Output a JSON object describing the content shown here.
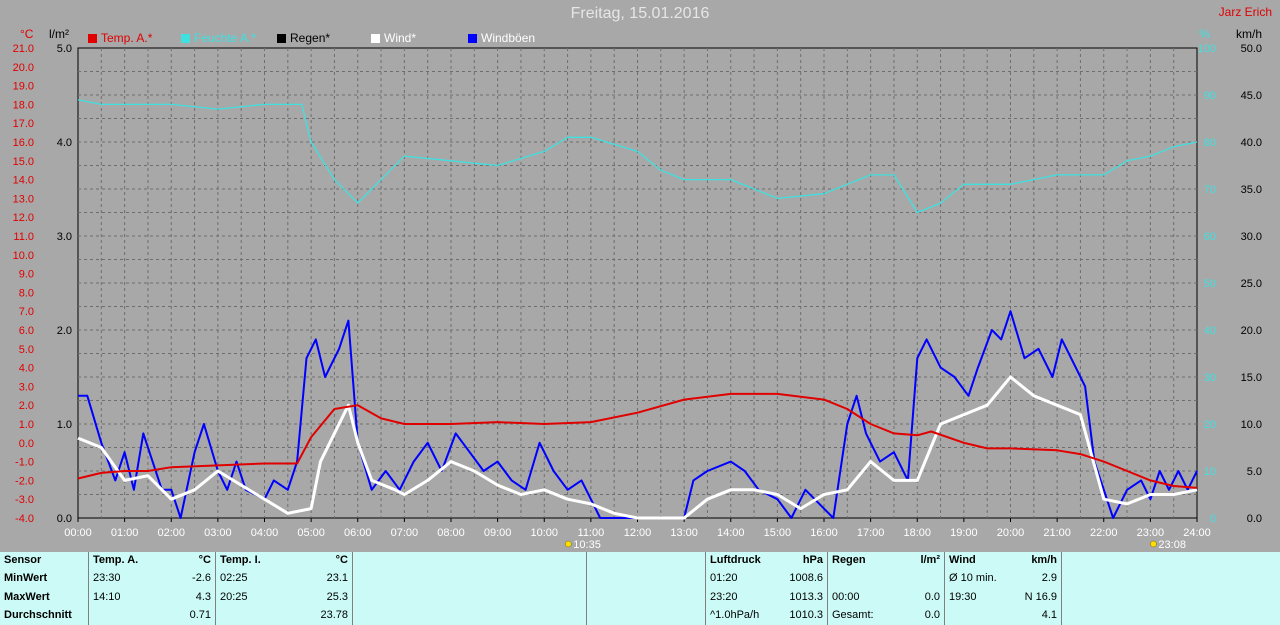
{
  "header": {
    "title": "Freitag, 15.01.2016",
    "author": "Jarz Erich"
  },
  "legend": [
    {
      "label": "Temp. A.*",
      "color": "#e00000",
      "labelColor": "#e00000"
    },
    {
      "label": "Feuchte A.*",
      "color": "#40e0e0",
      "labelColor": "#40e0e0"
    },
    {
      "label": "Regen*",
      "color": "#000000",
      "labelColor": "#000000"
    },
    {
      "label": "Wind*",
      "color": "#ffffff",
      "labelColor": "#ffffff"
    },
    {
      "label": "Windböen",
      "color": "#0000ff",
      "labelColor": "#ffffff"
    }
  ],
  "units": {
    "temp": "°C",
    "rain": "l/m²",
    "humidity": "%",
    "wind": "km/h"
  },
  "chart_data": {
    "type": "line",
    "title": "Freitag, 15.01.2016",
    "x_ticks": [
      "00:00",
      "01:00",
      "02:00",
      "03:00",
      "04:00",
      "05:00",
      "06:00",
      "07:00",
      "08:00",
      "09:00",
      "10:00",
      "11:00",
      "12:00",
      "13:00",
      "14:00",
      "15:00",
      "16:00",
      "17:00",
      "18:00",
      "19:00",
      "20:00",
      "21:00",
      "22:00",
      "23:00",
      "24:00"
    ],
    "x_range_hours": [
      0,
      24
    ],
    "axes": {
      "temp": {
        "unit": "°C",
        "min": -4,
        "max": 21,
        "step": 1,
        "ticks": [
          "-4.0",
          "-3.0",
          "-2.0",
          "-1.0",
          "0.0",
          "1.0",
          "2.0",
          "3.0",
          "4.0",
          "5.0",
          "6.0",
          "7.0",
          "8.0",
          "9.0",
          "10.0",
          "11.0",
          "12.0",
          "13.0",
          "14.0",
          "15.0",
          "16.0",
          "17.0",
          "18.0",
          "19.0",
          "20.0",
          "21.0"
        ]
      },
      "rain": {
        "unit": "l/m²",
        "min": 0,
        "max": 5,
        "ticks": [
          "0.0",
          "1.0",
          "2.0",
          "3.0",
          "4.0",
          "5.0"
        ]
      },
      "humidity": {
        "unit": "%",
        "min": 0,
        "max": 100,
        "ticks": [
          "0",
          "10",
          "20",
          "30",
          "40",
          "50",
          "60",
          "70",
          "80",
          "90",
          "100"
        ]
      },
      "wind": {
        "unit": "km/h",
        "min": 0,
        "max": 50,
        "ticks": [
          "0.0",
          "5.0",
          "10.0",
          "15.0",
          "20.0",
          "25.0",
          "30.0",
          "35.0",
          "40.0",
          "45.0",
          "50.0"
        ]
      }
    },
    "grid": true,
    "markers": [
      {
        "label": "10:35",
        "hour": 10.58
      },
      {
        "label": "23:08",
        "hour": 23.13
      }
    ],
    "series": [
      {
        "name": "Temp. A.*",
        "axis": "temp",
        "color": "#e00000",
        "points": [
          [
            0,
            -1.9
          ],
          [
            0.5,
            -1.6
          ],
          [
            1,
            -1.5
          ],
          [
            1.5,
            -1.5
          ],
          [
            2,
            -1.3
          ],
          [
            3,
            -1.2
          ],
          [
            4,
            -1.1
          ],
          [
            4.7,
            -1.1
          ],
          [
            5,
            0.3
          ],
          [
            5.5,
            1.8
          ],
          [
            6,
            2.0
          ],
          [
            6.5,
            1.3
          ],
          [
            7,
            1.0
          ],
          [
            8,
            1.0
          ],
          [
            9,
            1.1
          ],
          [
            10,
            1.0
          ],
          [
            11,
            1.1
          ],
          [
            12,
            1.6
          ],
          [
            13,
            2.3
          ],
          [
            14,
            2.6
          ],
          [
            15,
            2.6
          ],
          [
            16,
            2.3
          ],
          [
            16.5,
            1.8
          ],
          [
            17,
            1.0
          ],
          [
            17.5,
            0.5
          ],
          [
            18,
            0.4
          ],
          [
            18.3,
            0.6
          ],
          [
            19,
            0.0
          ],
          [
            19.5,
            -0.3
          ],
          [
            20,
            -0.3
          ],
          [
            21,
            -0.4
          ],
          [
            21.5,
            -0.6
          ],
          [
            22,
            -1.0
          ],
          [
            22.5,
            -1.5
          ],
          [
            23,
            -2.0
          ],
          [
            23.5,
            -2.3
          ],
          [
            24,
            -2.4
          ]
        ]
      },
      {
        "name": "Feuchte A.*",
        "axis": "humidity",
        "color": "#40e0e0",
        "points": [
          [
            0,
            89
          ],
          [
            0.5,
            88
          ],
          [
            1,
            88
          ],
          [
            2,
            88
          ],
          [
            3,
            87
          ],
          [
            4,
            88
          ],
          [
            4.8,
            88
          ],
          [
            5,
            80
          ],
          [
            5.5,
            72
          ],
          [
            6,
            67
          ],
          [
            6.5,
            72
          ],
          [
            7,
            77
          ],
          [
            8,
            76
          ],
          [
            9,
            75
          ],
          [
            10,
            78
          ],
          [
            10.5,
            81
          ],
          [
            11,
            81
          ],
          [
            12,
            78
          ],
          [
            12.5,
            74
          ],
          [
            13,
            72
          ],
          [
            14,
            72
          ],
          [
            15,
            68
          ],
          [
            16,
            69
          ],
          [
            17,
            73
          ],
          [
            17.5,
            73
          ],
          [
            18,
            65
          ],
          [
            18.5,
            67
          ],
          [
            19,
            71
          ],
          [
            20,
            71
          ],
          [
            21,
            73
          ],
          [
            22,
            73
          ],
          [
            22.5,
            76
          ],
          [
            23,
            77
          ],
          [
            23.5,
            79
          ],
          [
            24,
            80
          ]
        ]
      },
      {
        "name": "Wind*",
        "axis": "wind",
        "color": "#ffffff",
        "points": [
          [
            0,
            8.5
          ],
          [
            0.5,
            7.5
          ],
          [
            1,
            4
          ],
          [
            1.5,
            4.5
          ],
          [
            2,
            2
          ],
          [
            2.5,
            3
          ],
          [
            3,
            5
          ],
          [
            3.5,
            3.5
          ],
          [
            4,
            2
          ],
          [
            4.5,
            0.5
          ],
          [
            5,
            1
          ],
          [
            5.2,
            6
          ],
          [
            5.5,
            9
          ],
          [
            5.8,
            12
          ],
          [
            6,
            8
          ],
          [
            6.3,
            4
          ],
          [
            6.8,
            3
          ],
          [
            7,
            2.5
          ],
          [
            7.5,
            4
          ],
          [
            8,
            6
          ],
          [
            8.5,
            5
          ],
          [
            9,
            3.5
          ],
          [
            9.5,
            2.5
          ],
          [
            10,
            3
          ],
          [
            10.5,
            2
          ],
          [
            11,
            1.5
          ],
          [
            11.5,
            0.5
          ],
          [
            12,
            0
          ],
          [
            13,
            0
          ],
          [
            13.5,
            2
          ],
          [
            14,
            3
          ],
          [
            14.5,
            3
          ],
          [
            15,
            2.5
          ],
          [
            15.5,
            1
          ],
          [
            16,
            2.5
          ],
          [
            16.5,
            3
          ],
          [
            17,
            6
          ],
          [
            17.5,
            4
          ],
          [
            18,
            4
          ],
          [
            18.5,
            10
          ],
          [
            19,
            11
          ],
          [
            19.5,
            12
          ],
          [
            20,
            15
          ],
          [
            20.5,
            13
          ],
          [
            21,
            12
          ],
          [
            21.5,
            11
          ],
          [
            22,
            2
          ],
          [
            22.5,
            1.5
          ],
          [
            23,
            2.5
          ],
          [
            23.5,
            2.5
          ],
          [
            24,
            3
          ]
        ]
      },
      {
        "name": "Windböen",
        "axis": "wind",
        "color": "#0000ff",
        "points": [
          [
            0,
            13
          ],
          [
            0.2,
            13
          ],
          [
            0.5,
            8
          ],
          [
            0.8,
            4
          ],
          [
            1,
            7
          ],
          [
            1.2,
            3
          ],
          [
            1.4,
            9
          ],
          [
            1.6,
            6
          ],
          [
            1.8,
            3
          ],
          [
            2,
            3
          ],
          [
            2.2,
            0
          ],
          [
            2.5,
            7
          ],
          [
            2.7,
            10
          ],
          [
            3,
            5
          ],
          [
            3.2,
            3
          ],
          [
            3.4,
            6
          ],
          [
            3.6,
            3
          ],
          [
            4,
            2
          ],
          [
            4.2,
            4
          ],
          [
            4.5,
            3
          ],
          [
            4.7,
            6
          ],
          [
            4.9,
            17
          ],
          [
            5.1,
            19
          ],
          [
            5.3,
            15
          ],
          [
            5.6,
            18
          ],
          [
            5.8,
            21
          ],
          [
            6,
            8
          ],
          [
            6.3,
            3
          ],
          [
            6.6,
            5
          ],
          [
            6.9,
            3
          ],
          [
            7.2,
            6
          ],
          [
            7.5,
            8
          ],
          [
            7.8,
            5
          ],
          [
            8.1,
            9
          ],
          [
            8.4,
            7
          ],
          [
            8.7,
            5
          ],
          [
            9,
            6
          ],
          [
            9.3,
            4
          ],
          [
            9.6,
            3
          ],
          [
            9.9,
            8
          ],
          [
            10.2,
            5
          ],
          [
            10.5,
            3
          ],
          [
            10.8,
            4
          ],
          [
            11,
            2
          ],
          [
            11.2,
            0
          ],
          [
            11.4,
            0
          ],
          [
            13,
            0
          ],
          [
            13.2,
            4
          ],
          [
            13.5,
            5
          ],
          [
            14,
            6
          ],
          [
            14.3,
            5
          ],
          [
            14.6,
            3
          ],
          [
            15,
            2
          ],
          [
            15.3,
            0
          ],
          [
            15.6,
            3
          ],
          [
            15.8,
            2
          ],
          [
            16.2,
            0
          ],
          [
            16.5,
            10
          ],
          [
            16.7,
            13
          ],
          [
            16.9,
            9
          ],
          [
            17.2,
            6
          ],
          [
            17.5,
            7
          ],
          [
            17.8,
            4
          ],
          [
            18,
            17
          ],
          [
            18.2,
            19
          ],
          [
            18.5,
            16
          ],
          [
            18.8,
            15
          ],
          [
            19.1,
            13
          ],
          [
            19.3,
            16
          ],
          [
            19.6,
            20
          ],
          [
            19.8,
            19
          ],
          [
            20,
            22
          ],
          [
            20.3,
            17
          ],
          [
            20.6,
            18
          ],
          [
            20.9,
            15
          ],
          [
            21.1,
            19
          ],
          [
            21.4,
            16
          ],
          [
            21.6,
            14
          ],
          [
            21.8,
            6
          ],
          [
            22,
            3
          ],
          [
            22.2,
            0
          ],
          [
            22.5,
            3
          ],
          [
            22.8,
            4
          ],
          [
            23,
            2
          ],
          [
            23.2,
            5
          ],
          [
            23.4,
            3
          ],
          [
            23.6,
            5
          ],
          [
            23.8,
            3
          ],
          [
            24,
            5
          ]
        ]
      }
    ]
  },
  "panel": {
    "sensor": {
      "h": "Sensor",
      "min": "MinWert",
      "max": "MaxWert",
      "avg": "Durchschnitt"
    },
    "tempA": {
      "h": "Temp. A.",
      "unit": "°C",
      "minTime": "23:30",
      "minVal": "-2.6",
      "maxTime": "14:10",
      "maxVal": "4.3",
      "avg": "0.71"
    },
    "tempI": {
      "h": "Temp. I.",
      "unit": "°C",
      "minTime": "02:25",
      "minVal": "23.1",
      "maxTime": "20:25",
      "maxVal": "25.3",
      "avg": "23.78"
    },
    "pressure": {
      "h": "Luftdruck",
      "unit": "hPa",
      "minTime": "01:20",
      "minVal": "1008.6",
      "maxTime": "23:20",
      "maxVal": "1013.3",
      "trendLabel": "^1.0hPa/h",
      "trendVal": "1010.3"
    },
    "rain": {
      "h": "Regen",
      "unit": "l/m²",
      "r2Time": "00:00",
      "r2Val": "0.0",
      "r3Label": "Gesamt:",
      "r3Val": "0.0",
      "r1Val": "0.0"
    },
    "wind": {
      "h": "Wind",
      "unit": "km/h",
      "avgLabel": "Ø 10 min.",
      "avgVal": "2.9",
      "maxTime": "19:30",
      "maxVal": "N 16.9",
      "r3Val": "4.1"
    }
  }
}
